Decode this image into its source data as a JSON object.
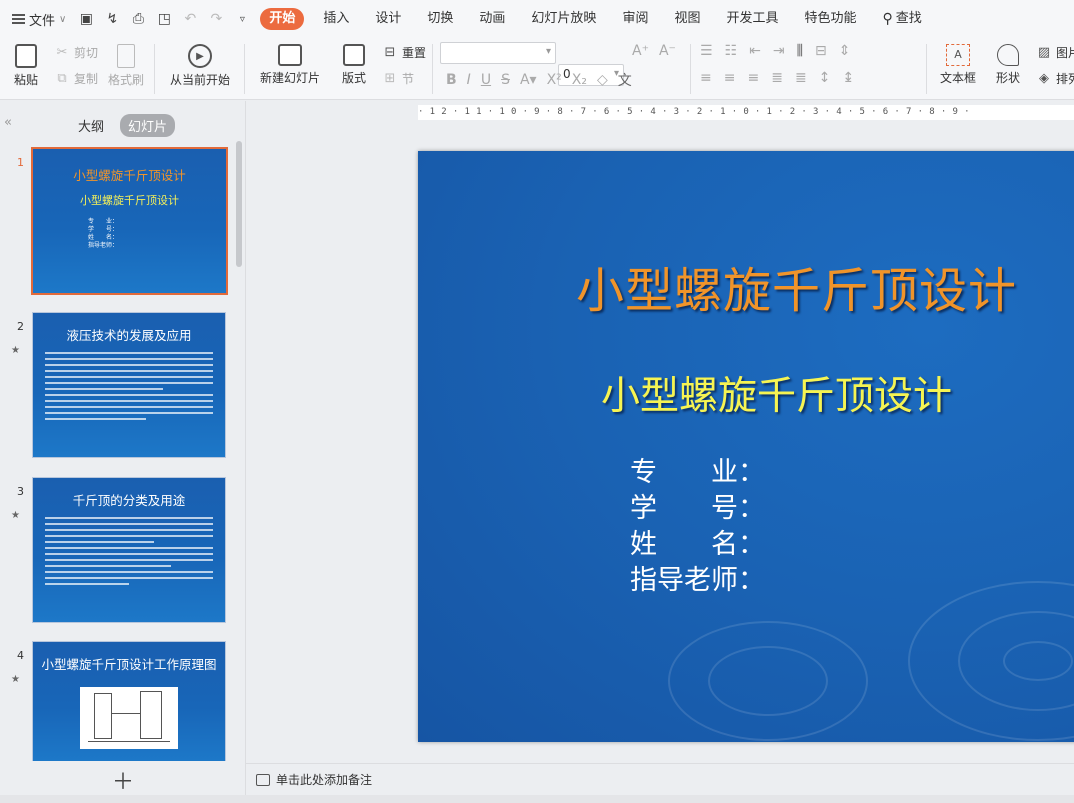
{
  "menubar": {
    "file_label": "文件",
    "tabs": [
      "开始",
      "插入",
      "设计",
      "切换",
      "动画",
      "幻灯片放映",
      "审阅",
      "视图",
      "开发工具",
      "特色功能"
    ],
    "search_label": "查找"
  },
  "ribbon": {
    "paste": "粘贴",
    "cut": "剪切",
    "copy": "复制",
    "format_painter": "格式刷",
    "from_current": "从当前开始",
    "new_slide": "新建幻灯片",
    "layout": "版式",
    "reset": "重置",
    "section": "节",
    "font_size": "0",
    "text_box": "文本框",
    "shape": "形状",
    "picture": "图片",
    "arrange": "排列"
  },
  "left_panel": {
    "tab_outline": "大纲",
    "tab_slides": "幻灯片",
    "slides": [
      {
        "num": "1",
        "title": "小型螺旋千斤顶设计",
        "subtitle": "小型螺旋千斤顶设计",
        "fields": [
          "专　　业：",
          "学　　号：",
          "姓　　名：",
          "指导老师："
        ]
      },
      {
        "num": "2",
        "title": "液压技术的发展及应用"
      },
      {
        "num": "3",
        "title": "千斤顶的分类及用途"
      },
      {
        "num": "4",
        "title": "小型螺旋千斤顶设计工作原理图"
      }
    ]
  },
  "ruler": {
    "scale": "·12·11·10·9·8·7·6·5·4·3·2·1·0·1·2·3·4·5·6·7·8·9·"
  },
  "slide": {
    "title": "小型螺旋千斤顶设计",
    "subtitle": "小型螺旋千斤顶设计",
    "fields": "专　　业：\n学　　号：\n姓　　名：\n指导老师："
  },
  "notes": {
    "placeholder": "单击此处添加备注"
  },
  "colors": {
    "accent": "#ec6b3f",
    "slide_bg": "#1a62b3",
    "title": "#f0942a",
    "subtitle": "#f6f452"
  }
}
